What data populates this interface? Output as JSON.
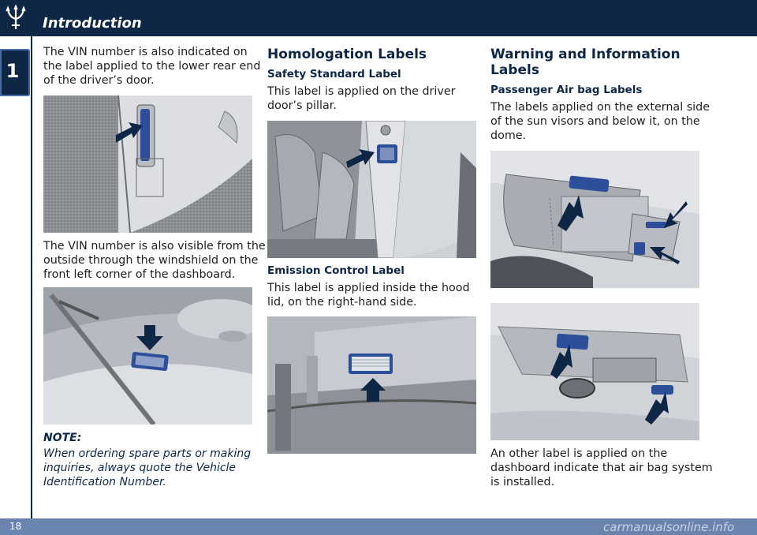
{
  "header": {
    "chapter_title": "Introduction",
    "chapter_number": "1"
  },
  "footer": {
    "page_number": "18",
    "watermark": "carmanualsonline.info"
  },
  "col1": {
    "p1": [
      "The VIN number is also indicated on",
      "the label applied to the lower rear end",
      "of the driver’s door."
    ],
    "p2": [
      "The VIN number is also visible from the",
      "outside through the windshield on the",
      "front left corner of the dashboard."
    ],
    "note_label": "NOTE:",
    "note_text": [
      "When ordering spare parts or making",
      "inquiries, always quote the Vehicle",
      "Identification Number."
    ]
  },
  "col2": {
    "heading": "Homologation Labels",
    "safety_heading": "Safety Standard Label",
    "safety_text": [
      "This label is applied on the driver",
      "door’s pillar."
    ],
    "emission_heading": "Emission Control Label",
    "emission_text": [
      "This label is applied inside the hood",
      "lid, on the right-hand side."
    ]
  },
  "col3": {
    "heading": [
      "Warning and Information",
      "Labels"
    ],
    "airbag_heading": "Passenger Air bag Labels",
    "airbag_text": [
      "The labels applied on the external side",
      "of the sun visors and below it, on the",
      "dome."
    ],
    "dash_text": [
      "An other label is applied on the",
      "dashboard indicate that air bag system",
      "is installed."
    ]
  },
  "colors": {
    "navy": "#0e2746",
    "footer": "#6b84ae",
    "label_blue": "#2d4f9a"
  }
}
